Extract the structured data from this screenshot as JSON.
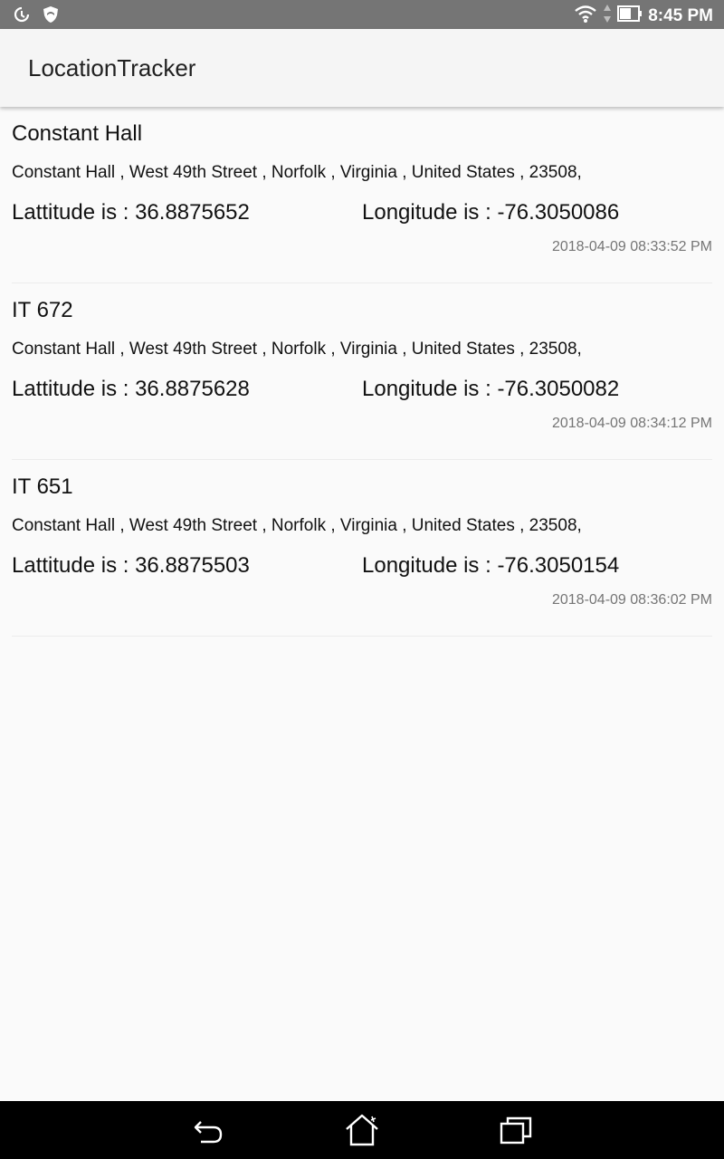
{
  "status_bar": {
    "time": "8:45 PM",
    "icons": [
      "sync-icon",
      "shield-icon",
      "wifi-icon",
      "data-arrows-icon",
      "battery-icon"
    ]
  },
  "app_bar": {
    "title": "LocationTracker"
  },
  "locations": [
    {
      "name": "Constant Hall",
      "address": "Constant Hall , West 49th Street , Norfolk , Virginia , United States , 23508,",
      "latitude": "Lattitude is : 36.8875652",
      "longitude": "Longitude is : -76.3050086",
      "timestamp": "2018-04-09 08:33:52 PM"
    },
    {
      "name": "IT 672",
      "address": "Constant Hall , West 49th Street , Norfolk , Virginia , United States , 23508,",
      "latitude": "Lattitude is : 36.8875628",
      "longitude": "Longitude is : -76.3050082",
      "timestamp": "2018-04-09 08:34:12 PM"
    },
    {
      "name": "IT 651",
      "address": "Constant Hall , West 49th Street , Norfolk , Virginia , United States , 23508,",
      "latitude": "Lattitude is : 36.8875503",
      "longitude": "Longitude is : -76.3050154",
      "timestamp": "2018-04-09 08:36:02 PM"
    }
  ],
  "nav_bar": {
    "icons": [
      "back-icon",
      "home-icon",
      "recents-icon"
    ]
  },
  "colors": {
    "status_bar": "#757575",
    "app_bar": "#f5f5f5",
    "background": "#fafafa",
    "nav_bar": "#000000"
  }
}
